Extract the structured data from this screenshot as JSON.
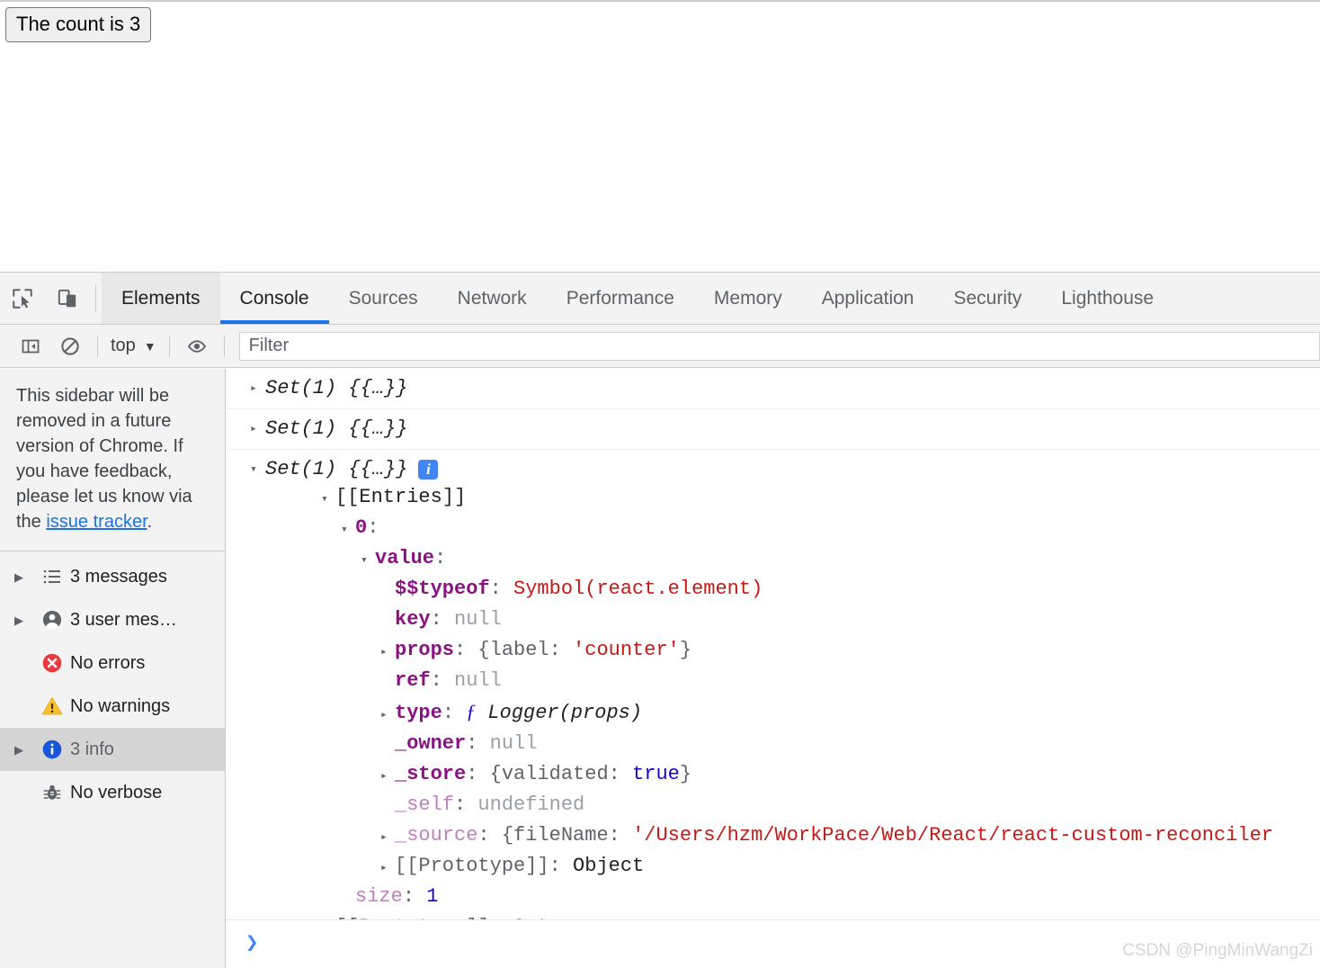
{
  "page": {
    "button_label": "The count is 3"
  },
  "devtools": {
    "toolbar_icons": [
      {
        "name": "inspect-element-icon"
      },
      {
        "name": "device-toolbar-icon"
      }
    ],
    "tabs": [
      {
        "label": "Elements",
        "state": "hovered"
      },
      {
        "label": "Console",
        "state": "active"
      },
      {
        "label": "Sources",
        "state": "normal"
      },
      {
        "label": "Network",
        "state": "normal"
      },
      {
        "label": "Performance",
        "state": "normal"
      },
      {
        "label": "Memory",
        "state": "normal"
      },
      {
        "label": "Application",
        "state": "normal"
      },
      {
        "label": "Security",
        "state": "normal"
      },
      {
        "label": "Lighthouse",
        "state": "normal"
      }
    ],
    "filterbar": {
      "sidebar_toggle": "show-console-sidebar-icon",
      "clear_console": "clear-console-icon",
      "context_value": "top",
      "context_caret": "▼",
      "live_expression": "eye-icon",
      "filter_placeholder": "Filter",
      "filter_value": ""
    },
    "accent_color": "#1a73e8"
  },
  "sidebar": {
    "notice": {
      "text_before": "This sidebar will be removed in a future version of Chrome. If you have feedback, please let us know via the ",
      "link_text": "issue tracker",
      "text_after": "."
    },
    "items": [
      {
        "label": "3 messages",
        "icon": "list-icon",
        "expandable": true,
        "selected": false
      },
      {
        "label": "3 user mes…",
        "icon": "user-icon",
        "expandable": true,
        "selected": false
      },
      {
        "label": "No errors",
        "icon": "error-icon",
        "expandable": false,
        "selected": false
      },
      {
        "label": "No warnings",
        "icon": "warning-icon",
        "expandable": false,
        "selected": false
      },
      {
        "label": "3 info",
        "icon": "info-icon",
        "expandable": true,
        "selected": true
      },
      {
        "label": "No verbose",
        "icon": "bug-icon",
        "expandable": false,
        "selected": false
      }
    ]
  },
  "console": {
    "messages": [
      {
        "preview": "Set(1) {{…}}",
        "arrow": "▸",
        "expanded": false,
        "badge": null
      },
      {
        "preview": "Set(1) {{…}}",
        "arrow": "▸",
        "expanded": false,
        "badge": null
      },
      {
        "preview": "Set(1) {{…}}",
        "arrow": "▾",
        "expanded": true,
        "badge": "i"
      }
    ],
    "tree": [
      {
        "indent": 0,
        "arrow": "▾",
        "key": "[[Entries]]",
        "key_class": "v-dark",
        "sep": "",
        "value": "",
        "value_class": ""
      },
      {
        "indent": 1,
        "arrow": "▾",
        "key": "0",
        "key_class": "k-prop",
        "sep": ":",
        "value": "",
        "value_class": ""
      },
      {
        "indent": 2,
        "arrow": "▾",
        "key": "value",
        "key_class": "k-prop",
        "sep": ":",
        "value": "",
        "value_class": ""
      },
      {
        "indent": 3,
        "arrow": "",
        "key": "$$typeof",
        "key_class": "k-prop",
        "sep": ": ",
        "value": "Symbol(react.element)",
        "value_class": "v-str"
      },
      {
        "indent": 3,
        "arrow": "",
        "key": "key",
        "key_class": "k-prop",
        "sep": ": ",
        "value": "null",
        "value_class": "v-null"
      },
      {
        "indent": 3,
        "arrow": "▸",
        "key": "props",
        "key_class": "k-prop",
        "sep": ": ",
        "value": "{label: 'counter'}",
        "value_class": "obj-inline"
      },
      {
        "indent": 3,
        "arrow": "",
        "key": "ref",
        "key_class": "k-prop",
        "sep": ": ",
        "value": "null",
        "value_class": "v-null"
      },
      {
        "indent": 3,
        "arrow": "▸",
        "key": "type",
        "key_class": "k-prop",
        "sep": ": ",
        "value": "ƒ Logger(props)",
        "value_class": "fn-inline"
      },
      {
        "indent": 3,
        "arrow": "",
        "key": "_owner",
        "key_class": "k-prop",
        "sep": ": ",
        "value": "null",
        "value_class": "v-null"
      },
      {
        "indent": 3,
        "arrow": "▸",
        "key": "_store",
        "key_class": "k-prop",
        "sep": ": ",
        "value": "{validated: true}",
        "value_class": "bool-inline"
      },
      {
        "indent": 3,
        "arrow": "",
        "key": "_self",
        "key_class": "k-own",
        "sep": ": ",
        "value": "undefined",
        "value_class": "v-null"
      },
      {
        "indent": 3,
        "arrow": "▸",
        "key": "_source",
        "key_class": "k-own",
        "sep": ": ",
        "value": "{fileName: '/Users/hzm/WorkPace/Web/React/react-custom-reconciler",
        "value_class": "src-inline"
      },
      {
        "indent": 3,
        "arrow": "▸",
        "key": "[[Prototype]]",
        "key_class": "v-obj",
        "sep": ": ",
        "value": "Object",
        "value_class": "v-dark"
      },
      {
        "indent": 1,
        "arrow": "",
        "key": "size",
        "key_class": "k-own",
        "sep": ": ",
        "value": "1",
        "value_class": "v-num"
      },
      {
        "indent": 0,
        "arrow": "▸",
        "key": "[[Prototype]]",
        "key_class": "v-obj",
        "sep": ": ",
        "value": "Set",
        "value_class": "v-dark"
      }
    ],
    "prompt_caret": "❯"
  },
  "watermark": "CSDN @PingMinWangZi"
}
